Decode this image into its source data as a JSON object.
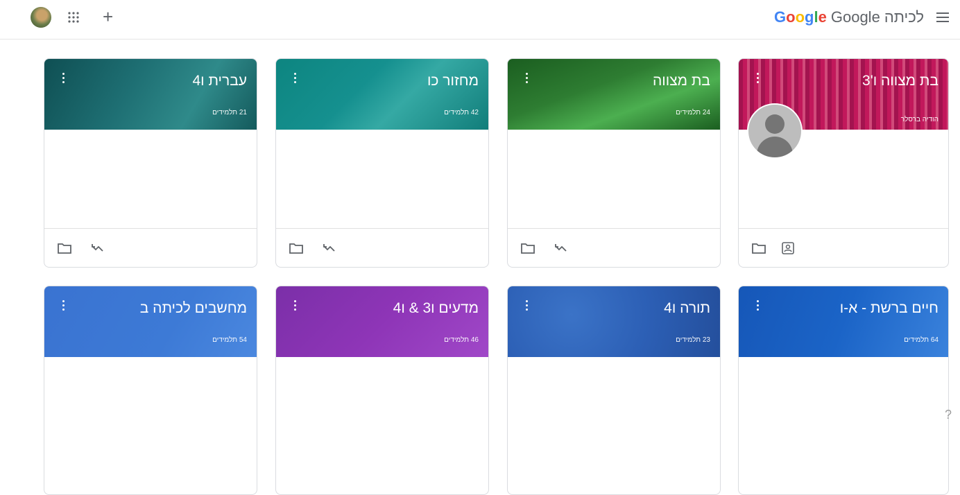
{
  "header": {
    "brand_words": [
      "לכיתה",
      "Google",
      "Google"
    ],
    "icons": [
      "avatar",
      "apps-icon",
      "add-icon",
      "menu-icon"
    ]
  },
  "cards": [
    {
      "title": "עברית ו4",
      "subtitle": "21 תלמידים",
      "footer_icons": [
        "folder-icon",
        "trend-icon"
      ],
      "color": "#1e6f73"
    },
    {
      "title": "מחזור כו",
      "subtitle": "42 תלמידים",
      "footer_icons": [
        "folder-icon",
        "trend-icon"
      ],
      "color": "#15908f"
    },
    {
      "title": "בת מצווה",
      "subtitle": "24 תלמידים",
      "footer_icons": [
        "folder-icon",
        "trend-icon"
      ],
      "color": "#2e7d32"
    },
    {
      "title": "בת מצווה ו'3",
      "subtitle": "הודיה ברסלר",
      "footer_icons": [
        "folder-icon",
        "class-roster-icon"
      ],
      "color": "#b0185a",
      "has_teacher_avatar": true
    },
    {
      "title": "מחשבים לכיתה ב",
      "subtitle": "54 תלמידים",
      "color": "#3d7ad6"
    },
    {
      "title": "מדעים ו3 & ו4",
      "subtitle": "46 תלמידים",
      "color": "#8e35b7"
    },
    {
      "title": "תורה ו4",
      "subtitle": "23 תלמידים",
      "color": "#2c5fb5"
    },
    {
      "title": "חיים ברשת - א-ו",
      "subtitle": "64 תלמידים",
      "color": "#1b64c7"
    }
  ]
}
